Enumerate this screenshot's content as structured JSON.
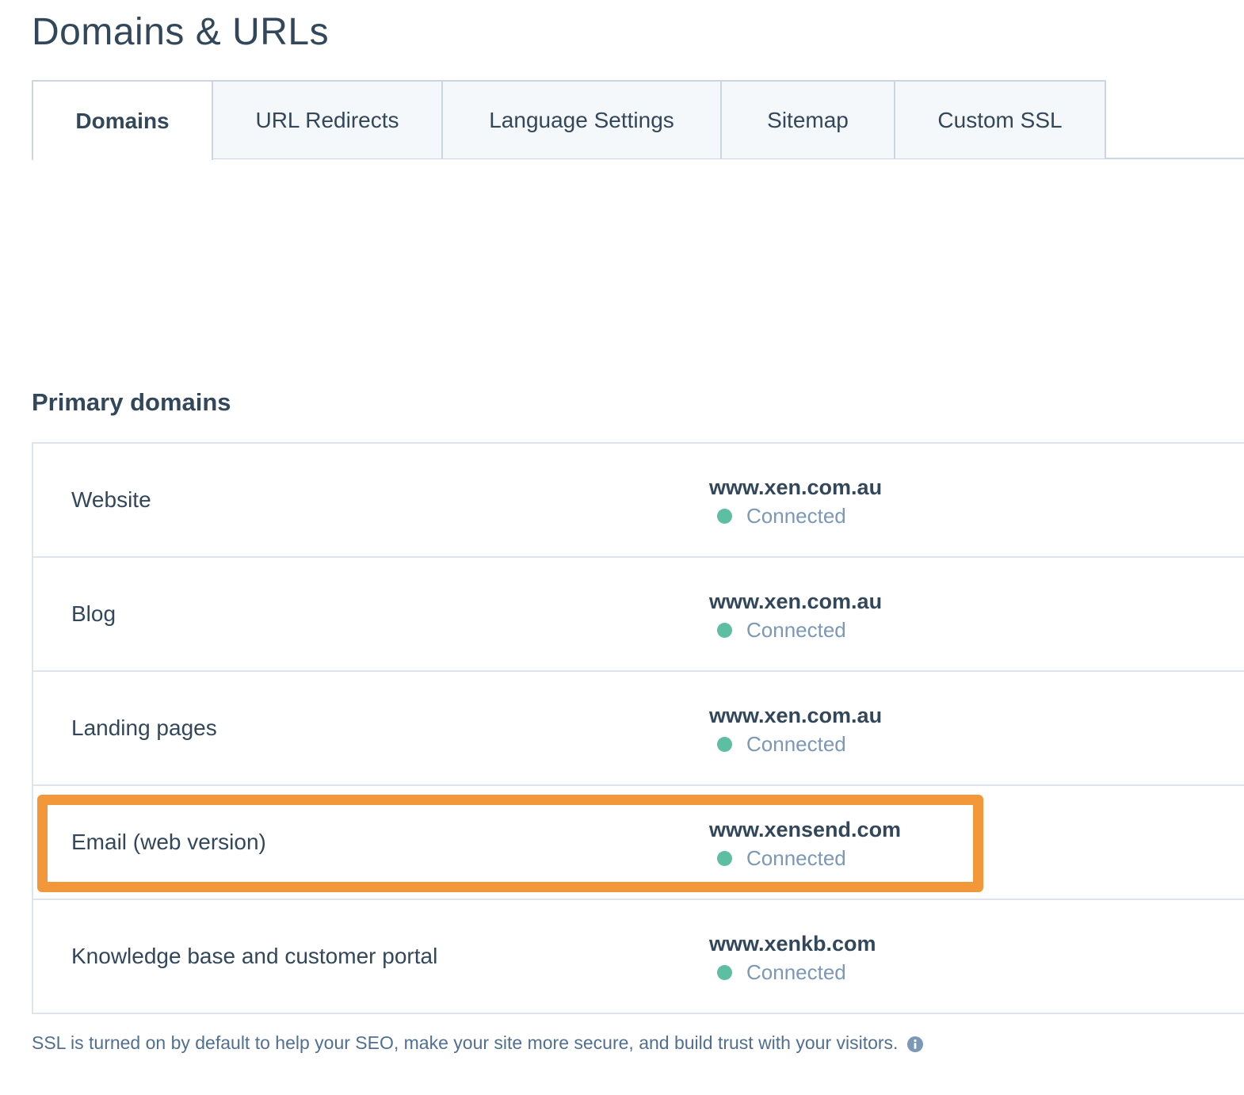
{
  "page": {
    "title": "Domains & URLs"
  },
  "tabs": [
    {
      "label": "Domains",
      "active": true
    },
    {
      "label": "URL Redirects",
      "active": false
    },
    {
      "label": "Language Settings",
      "active": false
    },
    {
      "label": "Sitemap",
      "active": false
    },
    {
      "label": "Custom SSL",
      "active": false
    }
  ],
  "primary_domains": {
    "title": "Primary domains",
    "rows": [
      {
        "label": "Website",
        "domain": "www.xen.com.au",
        "status": "Connected"
      },
      {
        "label": "Blog",
        "domain": "www.xen.com.au",
        "status": "Connected"
      },
      {
        "label": "Landing pages",
        "domain": "www.xen.com.au",
        "status": "Connected"
      },
      {
        "label": "Email (web version)",
        "domain": "www.xensend.com",
        "status": "Connected"
      },
      {
        "label": "Knowledge base and customer portal",
        "domain": "www.xenkb.com",
        "status": "Connected"
      }
    ],
    "status_color": "#5cbfa4",
    "highlight_color": "#f2973a"
  },
  "footnote": {
    "text": "SSL is turned on by default to help your SEO, make your site more secure, and build trust with your visitors.",
    "icon": "info-icon"
  }
}
